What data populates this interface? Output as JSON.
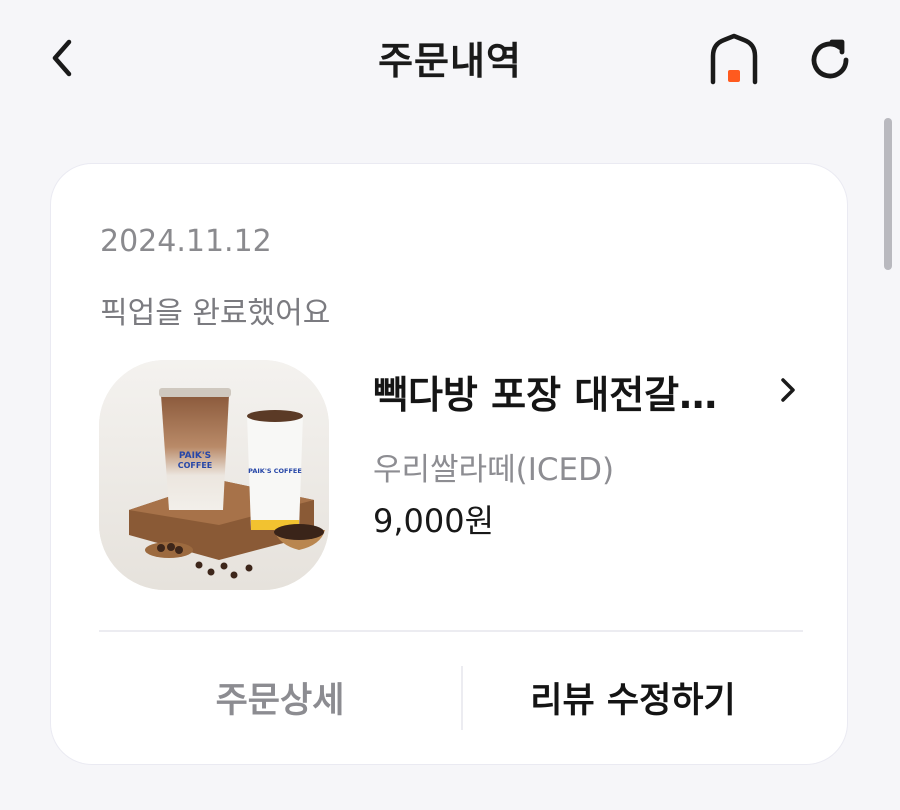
{
  "header": {
    "title": "주문내역",
    "icons": {
      "back": "chevron-left-icon",
      "home": "home-icon",
      "refresh": "refresh-icon"
    },
    "home_badge_color": "#ff5a1f"
  },
  "order": {
    "date": "2024.11.12",
    "status": "픽업을 완료했어요",
    "store_name": "빽다방 포장 대전갈…",
    "menu_name": "우리쌀라떼(ICED)",
    "price": "9,000원",
    "image_icon": "product-photo"
  },
  "actions": {
    "detail_label": "주문상세",
    "review_label": "리뷰 수정하기"
  }
}
